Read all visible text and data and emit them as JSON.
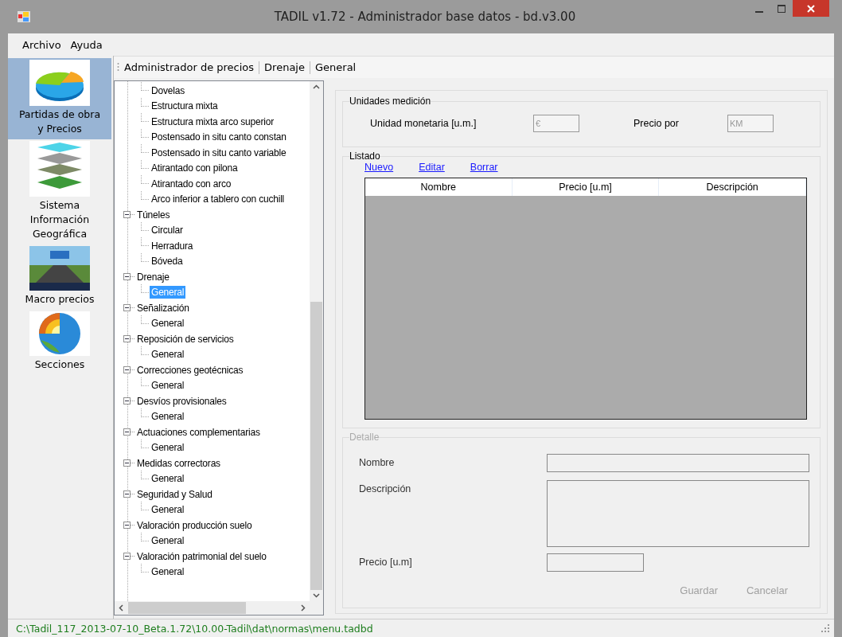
{
  "window": {
    "title": "TADIL v1.72 - Administrador base datos - bd.v3.00"
  },
  "menu": [
    "Archivo",
    "Ayuda"
  ],
  "sidebar": {
    "items": [
      {
        "label": "Partidas de obra y Precios",
        "kind": "pie",
        "selected": true
      },
      {
        "label": "Sistema Información Geográfica",
        "kind": "layers",
        "selected": false
      },
      {
        "label": "Macro precios",
        "kind": "road",
        "selected": false
      },
      {
        "label": "Secciones",
        "kind": "globe",
        "selected": false
      }
    ]
  },
  "breadcrumb": [
    "Administrador de precios",
    "Drenaje",
    "General"
  ],
  "tree": [
    {
      "children": [
        {
          "label": "Dovelas",
          "selected": false
        },
        {
          "label": "Estructura mixta",
          "selected": false
        },
        {
          "label": "Estructura mixta arco superior",
          "selected": false
        },
        {
          "label": "Postensado in situ canto constan",
          "selected": false
        },
        {
          "label": "Postensado in situ canto variable",
          "selected": false
        },
        {
          "label": "Atirantado con pilona",
          "selected": false
        },
        {
          "label": "Atirantado con arco",
          "selected": false
        },
        {
          "label": "Arco inferior a tablero con cuchill",
          "selected": false
        }
      ]
    },
    {
      "label": "Túneles",
      "expanded": true,
      "selected": false,
      "children": [
        {
          "label": "Circular",
          "selected": false
        },
        {
          "label": "Herradura",
          "selected": false
        },
        {
          "label": "Bóveda",
          "selected": false
        }
      ]
    },
    {
      "label": "Drenaje",
      "expanded": true,
      "selected": false,
      "children": [
        {
          "label": "General",
          "selected": true
        }
      ]
    },
    {
      "label": "Señalización",
      "expanded": true,
      "selected": false,
      "children": [
        {
          "label": "General",
          "selected": false
        }
      ]
    },
    {
      "label": "Reposición de servicios",
      "expanded": true,
      "selected": false,
      "children": [
        {
          "label": "General",
          "selected": false
        }
      ]
    },
    {
      "label": "Correcciones geotécnicas",
      "expanded": true,
      "selected": false,
      "children": [
        {
          "label": "General",
          "selected": false
        }
      ]
    },
    {
      "label": "Desvíos provisionales",
      "expanded": true,
      "selected": false,
      "children": [
        {
          "label": "General",
          "selected": false
        }
      ]
    },
    {
      "label": "Actuaciones complementarias",
      "expanded": true,
      "selected": false,
      "children": [
        {
          "label": "General",
          "selected": false
        }
      ]
    },
    {
      "label": "Medidas correctoras",
      "expanded": true,
      "selected": false,
      "children": [
        {
          "label": "General",
          "selected": false
        }
      ]
    },
    {
      "label": "Seguridad y Salud",
      "expanded": true,
      "selected": false,
      "children": [
        {
          "label": "General",
          "selected": false
        }
      ]
    },
    {
      "label": "Valoración producción suelo",
      "expanded": true,
      "selected": false,
      "children": [
        {
          "label": "General",
          "selected": false
        }
      ]
    },
    {
      "label": "Valoración patrimonial del suelo",
      "expanded": true,
      "selected": false,
      "children": [
        {
          "label": "General",
          "selected": false
        }
      ]
    }
  ],
  "units": {
    "title": "Unidades medición",
    "currency_label": "Unidad monetaria [u.m.]",
    "currency_value": "€",
    "per_label": "Precio por",
    "per_value": "KM",
    "disabled": true
  },
  "listing": {
    "title": "Listado",
    "links": [
      "Nuevo",
      "Editar",
      "Borrar"
    ],
    "columns": [
      "Nombre",
      "Precio [u.m]",
      "Descripción"
    ]
  },
  "detail": {
    "title": "Detalle",
    "disabled": true,
    "fields": [
      {
        "label": "Nombre",
        "kind": "line"
      },
      {
        "label": "Descripción",
        "kind": "area"
      },
      {
        "label": "Precio [u.m]",
        "kind": "short"
      }
    ],
    "buttons": [
      {
        "label": "Guardar",
        "disabled": true
      },
      {
        "label": "Cancelar",
        "disabled": true
      }
    ]
  },
  "status_bar": "C:\\Tadil_117_2013-07-10_Beta.1.72\\10.00-Tadil\\dat\\normas\\menu.tadbd"
}
